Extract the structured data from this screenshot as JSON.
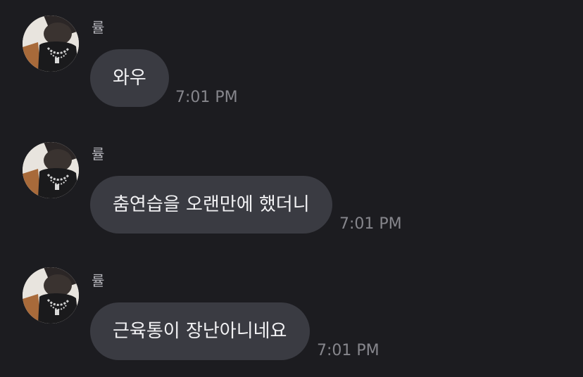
{
  "colors": {
    "background": "#1c1c20",
    "bubble": "#3a3b42",
    "message_text": "#f2f2f4",
    "sender_text": "#b5b5bb",
    "time_text": "#86868c"
  },
  "messages": [
    {
      "sender": "률",
      "avatar_icon": "profile-photo",
      "text": "와우",
      "time": "7:01 PM"
    },
    {
      "sender": "률",
      "avatar_icon": "profile-photo",
      "text": "춤연습을 오랜만에 했더니",
      "time": "7:01 PM"
    },
    {
      "sender": "률",
      "avatar_icon": "profile-photo",
      "text": "근육통이 장난아니네요",
      "time": "7:01 PM"
    }
  ]
}
